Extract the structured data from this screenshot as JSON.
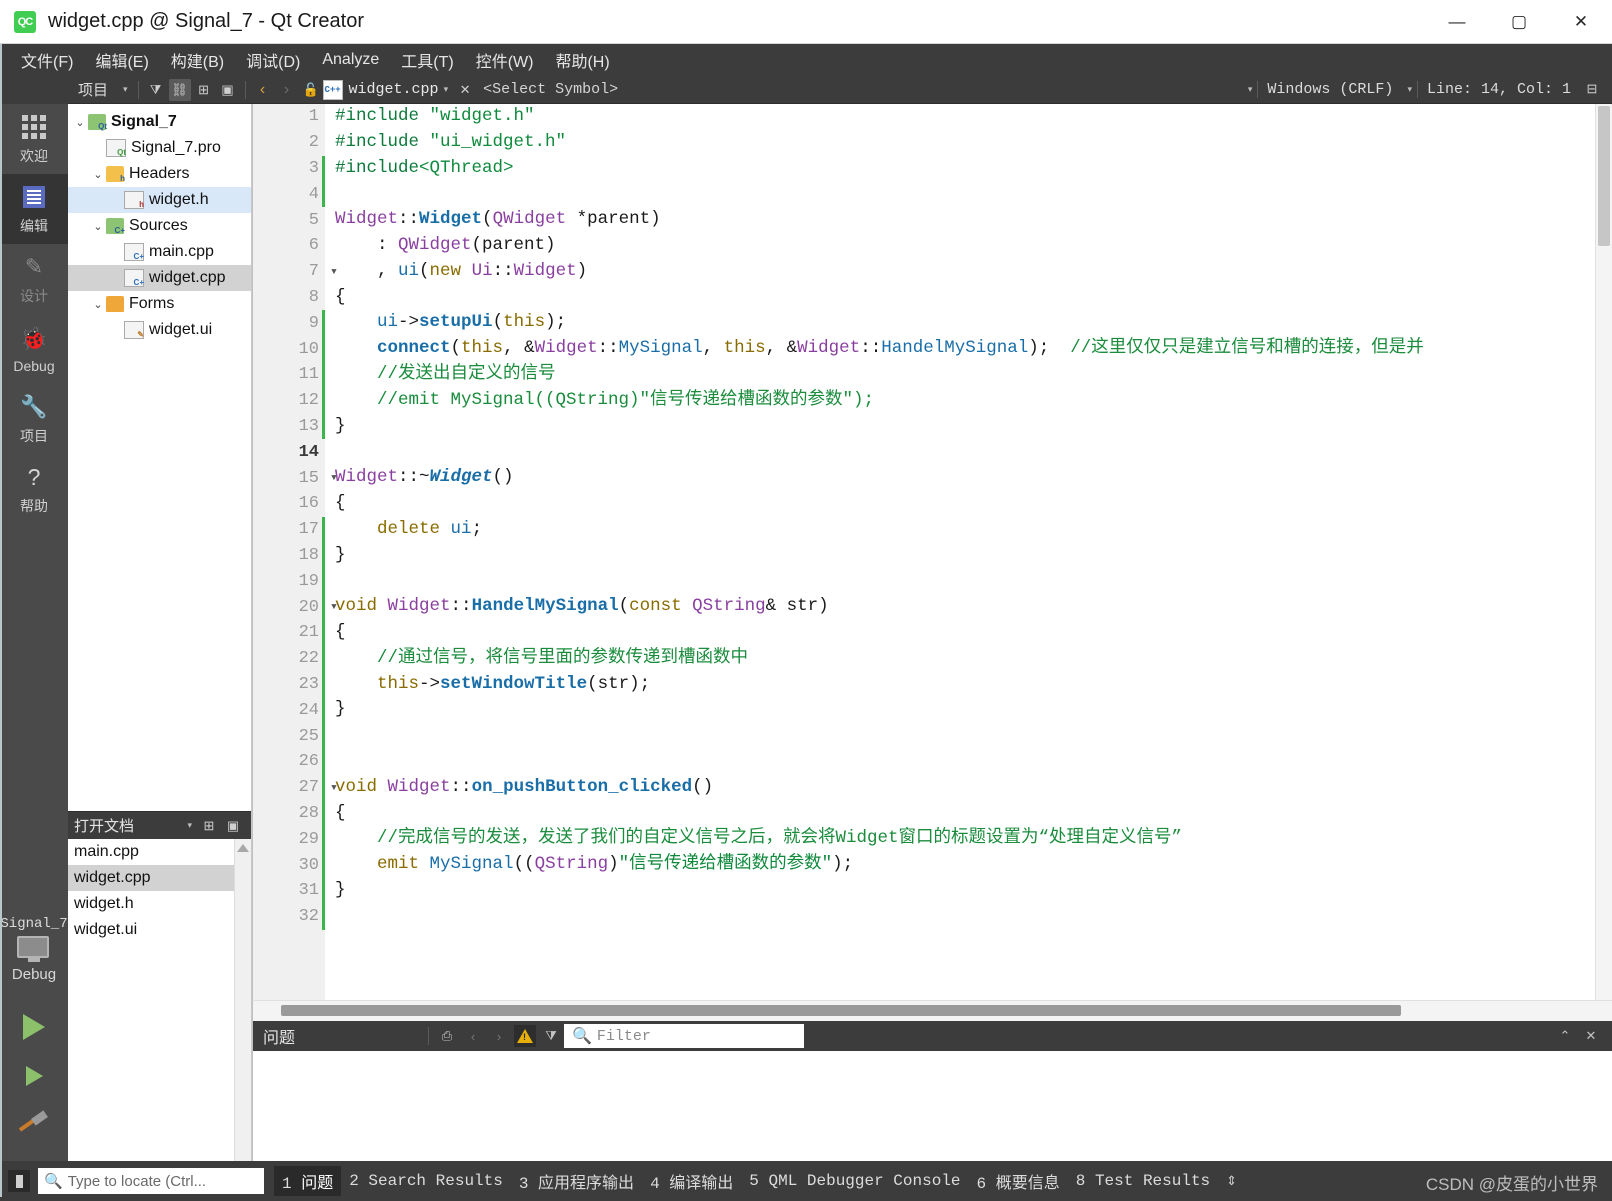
{
  "window": {
    "title": "widget.cpp @ Signal_7 - Qt Creator",
    "logo_text": "QC",
    "minimize": "—",
    "maximize": "▢",
    "close": "✕"
  },
  "menubar": {
    "items": [
      {
        "label": "文件(F)",
        "name": "menu-file"
      },
      {
        "label": "编辑(E)",
        "name": "menu-edit"
      },
      {
        "label": "构建(B)",
        "name": "menu-build"
      },
      {
        "label": "调试(D)",
        "name": "menu-debug"
      },
      {
        "label": "Analyze",
        "name": "menu-analyze"
      },
      {
        "label": "工具(T)",
        "name": "menu-tools"
      },
      {
        "label": "控件(W)",
        "name": "menu-window"
      },
      {
        "label": "帮助(H)",
        "name": "menu-help"
      }
    ]
  },
  "toolbar": {
    "view_selector": "项目",
    "file_name": "widget.cpp",
    "symbol_selector": "<Select Symbol>",
    "line_ending": "Windows (CRLF)",
    "cursor_position": "Line: 14, Col: 1",
    "close_label": "✕"
  },
  "modebar": {
    "items": [
      {
        "label": "欢迎",
        "name": "mode-welcome",
        "state": "normal"
      },
      {
        "label": "编辑",
        "name": "mode-edit",
        "state": "selected"
      },
      {
        "label": "设计",
        "name": "mode-design",
        "state": "disabled"
      },
      {
        "label": "Debug",
        "name": "mode-debug",
        "state": "normal"
      },
      {
        "label": "项目",
        "name": "mode-projects",
        "state": "normal"
      },
      {
        "label": "帮助",
        "name": "mode-help",
        "state": "normal"
      }
    ],
    "kit_name": "Signal_7",
    "build_config": "Debug"
  },
  "project_tree": {
    "nodes": [
      {
        "label": "Signal_7",
        "indent": 0,
        "arrow": "⌄",
        "icon": "qt-project-folder-icon",
        "bold": true,
        "selection": "none"
      },
      {
        "label": "Signal_7.pro",
        "indent": 1,
        "arrow": "",
        "icon": "pro-file-icon",
        "bold": false,
        "selection": "none"
      },
      {
        "label": "Headers",
        "indent": 1,
        "arrow": "⌄",
        "icon": "headers-folder-icon",
        "bold": false,
        "selection": "none"
      },
      {
        "label": "widget.h",
        "indent": 2,
        "arrow": "",
        "icon": "header-file-icon",
        "bold": false,
        "selection": "blue"
      },
      {
        "label": "Sources",
        "indent": 1,
        "arrow": "⌄",
        "icon": "sources-folder-icon",
        "bold": false,
        "selection": "none"
      },
      {
        "label": "main.cpp",
        "indent": 2,
        "arrow": "",
        "icon": "cpp-file-icon",
        "bold": false,
        "selection": "none"
      },
      {
        "label": "widget.cpp",
        "indent": 2,
        "arrow": "",
        "icon": "cpp-file-icon",
        "bold": false,
        "selection": "gray"
      },
      {
        "label": "Forms",
        "indent": 1,
        "arrow": "⌄",
        "icon": "forms-folder-icon",
        "bold": false,
        "selection": "none"
      },
      {
        "label": "widget.ui",
        "indent": 2,
        "arrow": "",
        "icon": "ui-file-icon",
        "bold": false,
        "selection": "none"
      }
    ]
  },
  "open_documents": {
    "title": "打开文档",
    "items": [
      {
        "label": "main.cpp",
        "selected": false
      },
      {
        "label": "widget.cpp",
        "selected": true
      },
      {
        "label": "widget.h",
        "selected": false
      },
      {
        "label": "widget.ui",
        "selected": false
      }
    ]
  },
  "editor": {
    "current_line": 14,
    "total_lines": 32,
    "lines": [
      {
        "n": 1,
        "fold": false,
        "changed": false,
        "tokens": [
          {
            "t": "#include ",
            "c": "k-pp"
          },
          {
            "t": "\"widget.h\"",
            "c": "k-str"
          }
        ]
      },
      {
        "n": 2,
        "fold": false,
        "changed": false,
        "tokens": [
          {
            "t": "#include ",
            "c": "k-pp"
          },
          {
            "t": "\"ui_widget.h\"",
            "c": "k-str"
          }
        ]
      },
      {
        "n": 3,
        "fold": false,
        "changed": true,
        "tokens": [
          {
            "t": "#include",
            "c": "k-pp"
          },
          {
            "t": "<QThread>",
            "c": "k-str"
          }
        ]
      },
      {
        "n": 4,
        "fold": false,
        "changed": true,
        "tokens": []
      },
      {
        "n": 5,
        "fold": false,
        "changed": false,
        "tokens": [
          {
            "t": "Widget",
            "c": "k-cls"
          },
          {
            "t": "::",
            "c": "k-op"
          },
          {
            "t": "Widget",
            "c": "k-fn"
          },
          {
            "t": "(",
            "c": "k-op"
          },
          {
            "t": "QWidget",
            "c": "k-cls"
          },
          {
            "t": " *parent)",
            "c": "k-plain"
          }
        ]
      },
      {
        "n": 6,
        "fold": false,
        "changed": false,
        "tokens": [
          {
            "t": "    : ",
            "c": "k-plain"
          },
          {
            "t": "QWidget",
            "c": "k-cls"
          },
          {
            "t": "(parent)",
            "c": "k-plain"
          }
        ]
      },
      {
        "n": 7,
        "fold": true,
        "changed": false,
        "tokens": [
          {
            "t": "    , ",
            "c": "k-plain"
          },
          {
            "t": "ui",
            "c": "k-member"
          },
          {
            "t": "(",
            "c": "k-op"
          },
          {
            "t": "new",
            "c": "k-kw"
          },
          {
            "t": " ",
            "c": "k-plain"
          },
          {
            "t": "Ui",
            "c": "k-cls"
          },
          {
            "t": "::",
            "c": "k-op"
          },
          {
            "t": "Widget",
            "c": "k-cls"
          },
          {
            "t": ")",
            "c": "k-op"
          }
        ]
      },
      {
        "n": 8,
        "fold": false,
        "changed": false,
        "tokens": [
          {
            "t": "{",
            "c": "k-plain"
          }
        ]
      },
      {
        "n": 9,
        "fold": false,
        "changed": true,
        "tokens": [
          {
            "t": "    ",
            "c": "k-plain"
          },
          {
            "t": "ui",
            "c": "k-member"
          },
          {
            "t": "->",
            "c": "k-op"
          },
          {
            "t": "setupUi",
            "c": "k-fn"
          },
          {
            "t": "(",
            "c": "k-op"
          },
          {
            "t": "this",
            "c": "k-kw"
          },
          {
            "t": ");",
            "c": "k-op"
          }
        ]
      },
      {
        "n": 10,
        "fold": false,
        "changed": true,
        "tokens": [
          {
            "t": "    ",
            "c": "k-plain"
          },
          {
            "t": "connect",
            "c": "k-fn"
          },
          {
            "t": "(",
            "c": "k-op"
          },
          {
            "t": "this",
            "c": "k-kw"
          },
          {
            "t": ", &",
            "c": "k-op"
          },
          {
            "t": "Widget",
            "c": "k-cls"
          },
          {
            "t": "::",
            "c": "k-op"
          },
          {
            "t": "MySignal",
            "c": "k-member"
          },
          {
            "t": ", ",
            "c": "k-op"
          },
          {
            "t": "this",
            "c": "k-kw"
          },
          {
            "t": ", &",
            "c": "k-op"
          },
          {
            "t": "Widget",
            "c": "k-cls"
          },
          {
            "t": "::",
            "c": "k-op"
          },
          {
            "t": "HandelMySignal",
            "c": "k-member"
          },
          {
            "t": ");  ",
            "c": "k-op"
          },
          {
            "t": "//这里仅仅只是建立信号和槽的连接，但是并",
            "c": "k-cmt"
          }
        ]
      },
      {
        "n": 11,
        "fold": false,
        "changed": true,
        "tokens": [
          {
            "t": "    //发送出自定义的信号",
            "c": "k-cmt"
          }
        ]
      },
      {
        "n": 12,
        "fold": false,
        "changed": true,
        "tokens": [
          {
            "t": "    //emit MySignal((QString)\"信号传递给槽函数的参数\");",
            "c": "k-cmt"
          }
        ]
      },
      {
        "n": 13,
        "fold": false,
        "changed": true,
        "tokens": [
          {
            "t": "}",
            "c": "k-plain"
          }
        ]
      },
      {
        "n": 14,
        "fold": false,
        "changed": false,
        "tokens": []
      },
      {
        "n": 15,
        "fold": true,
        "changed": false,
        "tokens": [
          {
            "t": "Widget",
            "c": "k-cls"
          },
          {
            "t": "::~",
            "c": "k-op"
          },
          {
            "t": "Widget",
            "c": "k-fni"
          },
          {
            "t": "()",
            "c": "k-op"
          }
        ]
      },
      {
        "n": 16,
        "fold": false,
        "changed": false,
        "tokens": [
          {
            "t": "{",
            "c": "k-plain"
          }
        ]
      },
      {
        "n": 17,
        "fold": false,
        "changed": true,
        "tokens": [
          {
            "t": "    ",
            "c": "k-plain"
          },
          {
            "t": "delete",
            "c": "k-kw"
          },
          {
            "t": " ",
            "c": "k-plain"
          },
          {
            "t": "ui",
            "c": "k-member"
          },
          {
            "t": ";",
            "c": "k-op"
          }
        ]
      },
      {
        "n": 18,
        "fold": false,
        "changed": true,
        "tokens": [
          {
            "t": "}",
            "c": "k-plain"
          }
        ]
      },
      {
        "n": 19,
        "fold": false,
        "changed": true,
        "tokens": []
      },
      {
        "n": 20,
        "fold": true,
        "changed": true,
        "tokens": [
          {
            "t": "void",
            "c": "k-kw"
          },
          {
            "t": " ",
            "c": "k-plain"
          },
          {
            "t": "Widget",
            "c": "k-cls"
          },
          {
            "t": "::",
            "c": "k-op"
          },
          {
            "t": "HandelMySignal",
            "c": "k-fn"
          },
          {
            "t": "(",
            "c": "k-op"
          },
          {
            "t": "const",
            "c": "k-kw"
          },
          {
            "t": " ",
            "c": "k-plain"
          },
          {
            "t": "QString",
            "c": "k-cls"
          },
          {
            "t": "& str)",
            "c": "k-plain"
          }
        ]
      },
      {
        "n": 21,
        "fold": false,
        "changed": true,
        "tokens": [
          {
            "t": "{",
            "c": "k-plain"
          }
        ]
      },
      {
        "n": 22,
        "fold": false,
        "changed": true,
        "tokens": [
          {
            "t": "    //通过信号，将信号里面的参数传递到槽函数中",
            "c": "k-cmt"
          }
        ]
      },
      {
        "n": 23,
        "fold": false,
        "changed": true,
        "tokens": [
          {
            "t": "    ",
            "c": "k-plain"
          },
          {
            "t": "this",
            "c": "k-kw"
          },
          {
            "t": "->",
            "c": "k-op"
          },
          {
            "t": "setWindowTitle",
            "c": "k-fn"
          },
          {
            "t": "(str);",
            "c": "k-plain"
          }
        ]
      },
      {
        "n": 24,
        "fold": false,
        "changed": true,
        "tokens": [
          {
            "t": "}",
            "c": "k-plain"
          }
        ]
      },
      {
        "n": 25,
        "fold": false,
        "changed": true,
        "tokens": []
      },
      {
        "n": 26,
        "fold": false,
        "changed": true,
        "tokens": []
      },
      {
        "n": 27,
        "fold": true,
        "changed": true,
        "tokens": [
          {
            "t": "void",
            "c": "k-kw"
          },
          {
            "t": " ",
            "c": "k-plain"
          },
          {
            "t": "Widget",
            "c": "k-cls"
          },
          {
            "t": "::",
            "c": "k-op"
          },
          {
            "t": "on_pushButton_clicked",
            "c": "k-fn"
          },
          {
            "t": "()",
            "c": "k-op"
          }
        ]
      },
      {
        "n": 28,
        "fold": false,
        "changed": true,
        "tokens": [
          {
            "t": "{",
            "c": "k-plain"
          }
        ]
      },
      {
        "n": 29,
        "fold": false,
        "changed": true,
        "tokens": [
          {
            "t": "    //完成信号的发送，发送了我们的自定义信号之后，就会将Widget窗口的标题设置为“处理自定义信号”",
            "c": "k-cmt"
          }
        ]
      },
      {
        "n": 30,
        "fold": false,
        "changed": true,
        "tokens": [
          {
            "t": "    ",
            "c": "k-plain"
          },
          {
            "t": "emit",
            "c": "k-kw"
          },
          {
            "t": " ",
            "c": "k-plain"
          },
          {
            "t": "MySignal",
            "c": "k-member"
          },
          {
            "t": "((",
            "c": "k-op"
          },
          {
            "t": "QString",
            "c": "k-cls"
          },
          {
            "t": ")",
            "c": "k-op"
          },
          {
            "t": "\"信号传递给槽函数的参数\"",
            "c": "k-str"
          },
          {
            "t": ");",
            "c": "k-op"
          }
        ]
      },
      {
        "n": 31,
        "fold": false,
        "changed": true,
        "tokens": [
          {
            "t": "}",
            "c": "k-plain"
          }
        ]
      },
      {
        "n": 32,
        "fold": false,
        "changed": true,
        "tokens": []
      }
    ]
  },
  "output_panel": {
    "title": "问题",
    "filter_placeholder": "Filter"
  },
  "statusbar": {
    "locate_placeholder": "Type to locate (Ctrl...",
    "tabs": [
      {
        "num": "1",
        "label": "问题",
        "active": true
      },
      {
        "num": "2",
        "label": "Search Results",
        "active": false
      },
      {
        "num": "3",
        "label": "应用程序输出",
        "active": false
      },
      {
        "num": "4",
        "label": "编译输出",
        "active": false
      },
      {
        "num": "5",
        "label": "QML Debugger Console",
        "active": false
      },
      {
        "num": "6",
        "label": "概要信息",
        "active": false
      },
      {
        "num": "8",
        "label": "Test Results",
        "active": false
      }
    ],
    "watermark": "CSDN @皮蛋的小世界"
  },
  "colors": {
    "accent_green": "#41cd52",
    "chrome_dark": "#3c3c3c",
    "mode_bar": "#4a4a4a",
    "selection_blue": "#d8e8f8",
    "selection_gray": "#d2d2d2",
    "change_marker": "#3ab54a"
  }
}
